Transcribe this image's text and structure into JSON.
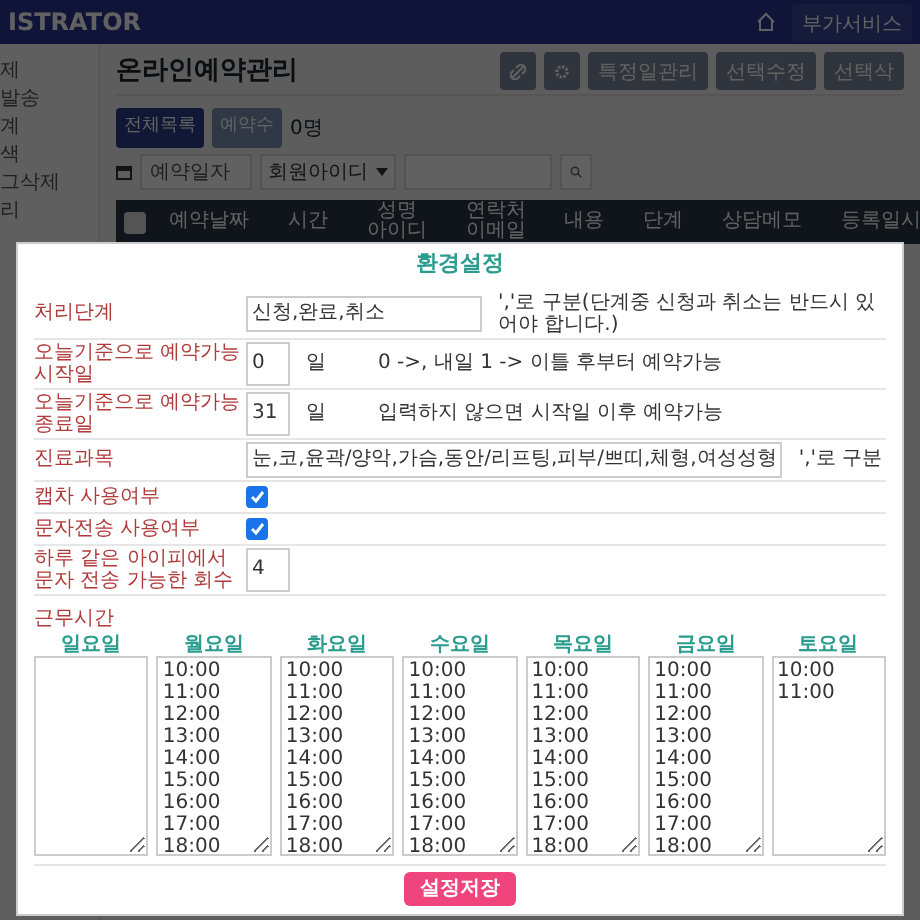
{
  "header": {
    "brand": "ISTRATOR",
    "service_button": "부가서비스"
  },
  "sidebar": {
    "items": [
      "제",
      "발송",
      "계",
      "색",
      "그삭제",
      "리"
    ]
  },
  "page": {
    "title": "온라인예약관리",
    "toolbar_buttons": [
      "특정일관리",
      "선택수정",
      "선택삭"
    ]
  },
  "tabs": [
    {
      "label": "전체목록",
      "selected": true
    },
    {
      "label": "예약수",
      "selected": false
    }
  ],
  "count": "0명",
  "search": {
    "date_placeholder": "예약일자",
    "field_select": "회원아이디"
  },
  "table": {
    "select_all_checked": false,
    "columns": [
      "예약날짜",
      "시간",
      "성명\n아이디",
      "연락처\n이메일",
      "내용",
      "단계",
      "상담메모",
      "등록일시"
    ]
  },
  "modal": {
    "title": "환경설정",
    "fields": [
      {
        "kind": "text",
        "label": "처리단계",
        "value": "신청,완료,취소",
        "note": "','로 구분(단계중 신청과 취소는 반드시 있어야 합니다.)"
      },
      {
        "kind": "number",
        "label": "오늘기준으로 예약가능 시작일",
        "value": "0",
        "unit": "일",
        "note": "0 ->, 내일 1 -> 이틀 후부터 예약가능"
      },
      {
        "kind": "number",
        "label": "오늘기준으로 예약가능 종료일",
        "value": "31",
        "unit": "일",
        "note": "입력하지 않으면 시작일 이후 예약가능"
      },
      {
        "kind": "text",
        "label": "진료과목",
        "value": "눈,코,윤곽/양악,가슴,동안/리프팅,피부/쁘띠,체형,여성성형",
        "note": "','로 구분"
      },
      {
        "kind": "checkbox",
        "label": "캡차 사용여부",
        "checked": true
      },
      {
        "kind": "checkbox",
        "label": "문자전송 사용여부",
        "checked": true
      },
      {
        "kind": "number",
        "label": "하루 같은 아이피에서 문자 전송 가능한 회수",
        "value": "4"
      }
    ],
    "work_hours": {
      "label": "근무시간",
      "days": [
        {
          "name": "일요일"
        },
        {
          "name": "월요일",
          "times": [
            "10:00",
            "11:00",
            "12:00",
            "13:00",
            "14:00",
            "15:00",
            "16:00",
            "17:00",
            "18:00"
          ]
        },
        {
          "name": "화요일",
          "times": [
            "10:00",
            "11:00",
            "12:00",
            "13:00",
            "14:00",
            "15:00",
            "16:00",
            "17:00",
            "18:00"
          ]
        },
        {
          "name": "수요일",
          "times": [
            "10:00",
            "11:00",
            "12:00",
            "13:00",
            "14:00",
            "15:00",
            "16:00",
            "17:00",
            "18:00"
          ]
        },
        {
          "name": "목요일",
          "times": [
            "10:00",
            "11:00",
            "12:00",
            "13:00",
            "14:00",
            "15:00",
            "16:00",
            "17:00",
            "18:00"
          ]
        },
        {
          "name": "금요일",
          "times": [
            "10:00",
            "11:00",
            "12:00",
            "13:00",
            "14:00",
            "15:00",
            "16:00",
            "17:00",
            "18:00"
          ]
        },
        {
          "name": "토요일",
          "times": [
            "10:00",
            "11:00"
          ]
        }
      ]
    },
    "save_button": "설정저장"
  }
}
